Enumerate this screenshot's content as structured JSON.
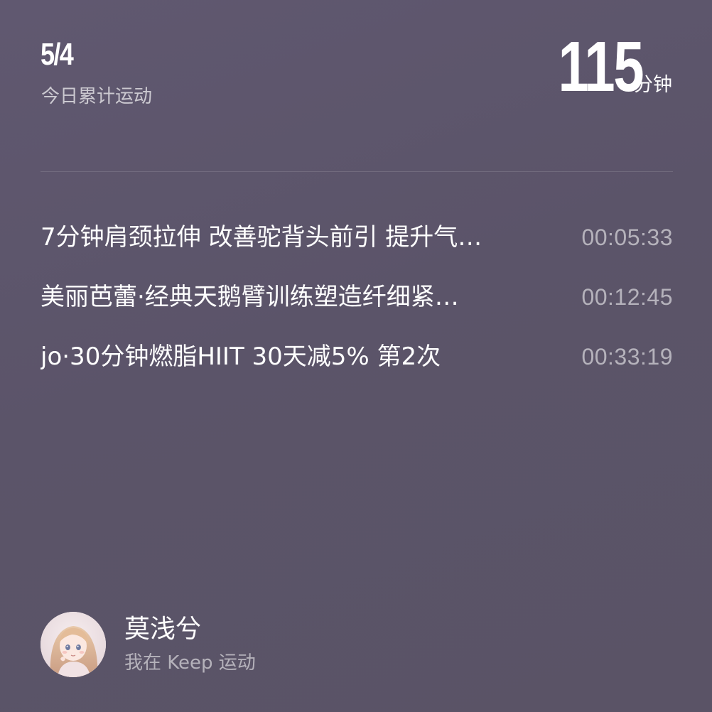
{
  "header": {
    "date": "5/4",
    "subtitle": "今日累计运动",
    "total_value": "115",
    "total_unit": "分钟"
  },
  "workouts": [
    {
      "title": "7分钟肩颈拉伸 改善驼背头前引 提升气…",
      "duration": "00:05:33"
    },
    {
      "title": "美丽芭蕾·经典天鹅臂训练塑造纤细紧…",
      "duration": "00:12:45"
    },
    {
      "title": "jo·30分钟燃脂HIIT 30天减5% 第2次",
      "duration": "00:33:19"
    }
  ],
  "profile": {
    "name": "莫浅兮",
    "subtitle": "我在 Keep 运动",
    "avatar_icon": "avatar-icon"
  },
  "colors": {
    "background": "#5c5569",
    "primary_text": "#ffffff",
    "secondary_text": "#b3aebb"
  }
}
